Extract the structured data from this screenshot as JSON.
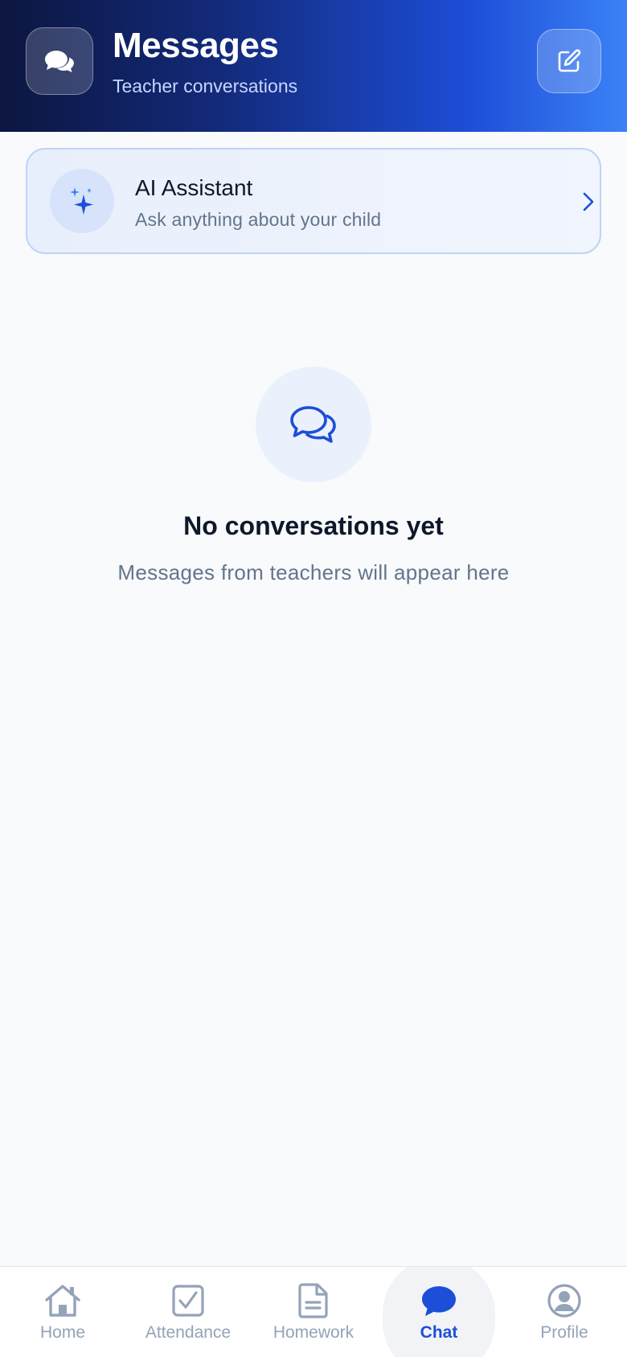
{
  "header": {
    "title": "Messages",
    "subtitle": "Teacher conversations",
    "left_icon": "chat-bubbles-icon",
    "compose_icon": "compose-icon"
  },
  "ai_card": {
    "title": "AI Assistant",
    "subtitle": "Ask anything about your child",
    "icon": "sparkles-icon",
    "chevron_icon": "chevron-right-icon"
  },
  "empty_state": {
    "icon": "chat-bubbles-icon",
    "title": "No conversations yet",
    "subtitle": "Messages from teachers will appear here"
  },
  "bottom_nav": {
    "items": [
      {
        "label": "Home",
        "icon": "home-icon",
        "active": false
      },
      {
        "label": "Attendance",
        "icon": "checkbox-icon",
        "active": false
      },
      {
        "label": "Homework",
        "icon": "document-icon",
        "active": false
      },
      {
        "label": "Chat",
        "icon": "chat-icon",
        "active": true
      },
      {
        "label": "Profile",
        "icon": "user-circle-icon",
        "active": false
      }
    ]
  },
  "colors": {
    "accent": "#1d4ed8",
    "header_gradient_start": "#0c1640",
    "header_gradient_end": "#3b82f6",
    "text_primary": "#0f172a",
    "text_muted": "#64748b",
    "nav_inactive": "#94a3b8"
  }
}
